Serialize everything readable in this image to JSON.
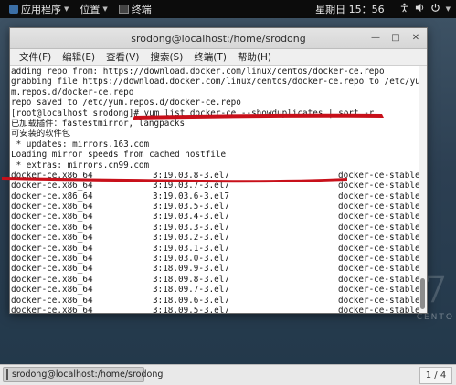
{
  "topbar": {
    "applications": "应用程序",
    "places": "位置",
    "terminal": "终端",
    "clock": "星期日 15：56"
  },
  "desktop": {
    "watermark": "CENTO"
  },
  "window": {
    "title": "srodong@localhost:/home/srodong",
    "menu": [
      "文件(F)",
      "编辑(E)",
      "查看(V)",
      "搜索(S)",
      "终端(T)",
      "帮助(H)"
    ]
  },
  "terminal": {
    "lines": [
      "adding repo from: https://download.docker.com/linux/centos/docker-ce.repo",
      "grabbing file https://download.docker.com/linux/centos/docker-ce.repo to /etc/yu",
      "m.repos.d/docker-ce.repo",
      "repo saved to /etc/yum.repos.d/docker-ce.repo",
      "[root@localhost srodong]# yum list docker-ce --showduplicates | sort -r",
      "已加载插件：fastestmirror, langpacks",
      "可安装的软件包",
      " * updates: mirrors.163.com",
      "Loading mirror speeds from cached hostfile",
      " * extras: mirrors.cn99.com"
    ],
    "rows": [
      [
        "docker-ce.x86_64",
        "3:19.03.8-3.el7",
        "docker-ce-stable"
      ],
      [
        "docker-ce.x86_64",
        "3:19.03.7-3.el7",
        "docker-ce-stable"
      ],
      [
        "docker-ce.x86_64",
        "3:19.03.6-3.el7",
        "docker-ce-stable"
      ],
      [
        "docker-ce.x86_64",
        "3:19.03.5-3.el7",
        "docker-ce-stable"
      ],
      [
        "docker-ce.x86_64",
        "3:19.03.4-3.el7",
        "docker-ce-stable"
      ],
      [
        "docker-ce.x86_64",
        "3:19.03.3-3.el7",
        "docker-ce-stable"
      ],
      [
        "docker-ce.x86_64",
        "3:19.03.2-3.el7",
        "docker-ce-stable"
      ],
      [
        "docker-ce.x86_64",
        "3:19.03.1-3.el7",
        "docker-ce-stable"
      ],
      [
        "docker-ce.x86_64",
        "3:19.03.0-3.el7",
        "docker-ce-stable"
      ],
      [
        "docker-ce.x86_64",
        "3:18.09.9-3.el7",
        "docker-ce-stable"
      ],
      [
        "docker-ce.x86_64",
        "3:18.09.8-3.el7",
        "docker-ce-stable"
      ],
      [
        "docker-ce.x86_64",
        "3:18.09.7-3.el7",
        "docker-ce-stable"
      ],
      [
        "docker-ce.x86_64",
        "3:18.09.6-3.el7",
        "docker-ce-stable"
      ],
      [
        "docker-ce.x86_64",
        "3:18.09.5-3.el7",
        "docker-ce-stable"
      ]
    ]
  },
  "taskbar": {
    "task_label": "srodong@localhost:/home/srodong",
    "pager": "1 / 4"
  }
}
